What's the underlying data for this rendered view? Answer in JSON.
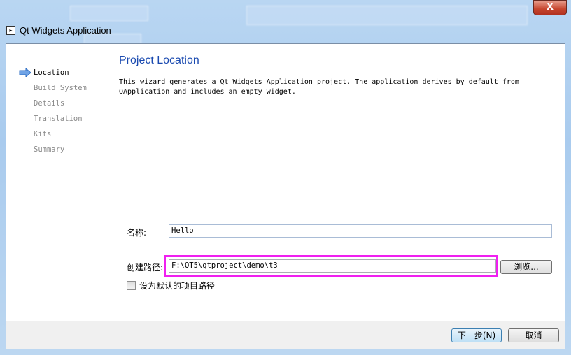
{
  "window": {
    "title": "Qt Widgets Application",
    "close_glyph": "X"
  },
  "steps": [
    {
      "label": "Location",
      "active": true
    },
    {
      "label": "Build System",
      "active": false
    },
    {
      "label": "Details",
      "active": false
    },
    {
      "label": "Translation",
      "active": false
    },
    {
      "label": "Kits",
      "active": false
    },
    {
      "label": "Summary",
      "active": false
    }
  ],
  "page": {
    "title": "Project Location",
    "description": "This wizard generates a Qt Widgets Application project. The application derives by default from QApplication and includes an empty widget."
  },
  "form": {
    "name_label": "名称:",
    "name_value": "Hello",
    "path_label": "创建路径:",
    "path_value": "F:\\QT5\\qtproject\\demo\\t3",
    "browse_label": "浏览...",
    "default_path_label": "设为默认的项目路径",
    "default_path_checked": false
  },
  "footer": {
    "next_label": "下一步(N)",
    "cancel_label": "取消"
  },
  "colors": {
    "title_blue": "#1a4ab0",
    "highlight": "#f020f0"
  }
}
